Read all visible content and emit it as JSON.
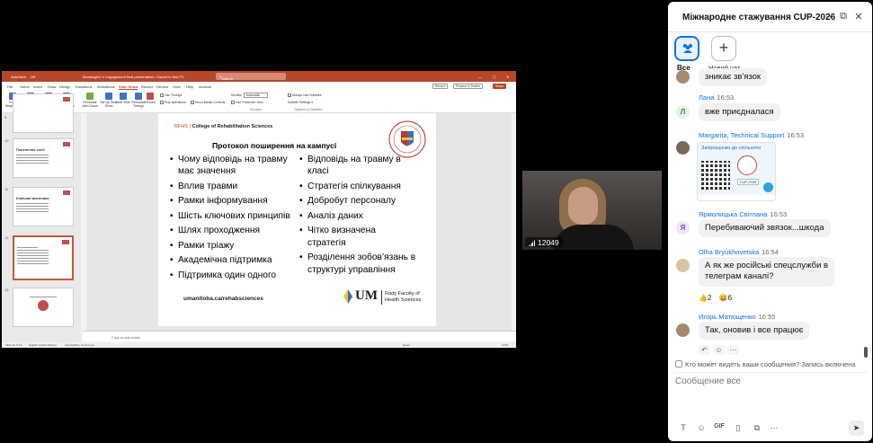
{
  "ppt": {
    "autosave": "AutoSave",
    "autosave_state": "Off",
    "doc_title": "Meaningful 'n' engagement final presentation • Saved to this PC",
    "search": "Search",
    "menu": [
      "File",
      "Home",
      "Insert",
      "Draw",
      "Design",
      "Transitions",
      "Animations",
      "Slide Show",
      "Record",
      "Review",
      "View",
      "Help",
      "Acrobat"
    ],
    "menu_active": "Slide Show",
    "record_btn": "Record",
    "present_btn": "Present in Teams",
    "share_btn": "Share",
    "ribbon": {
      "from_beginning": "From Beginning",
      "from_current": "From Current Slide",
      "present_teams": "Present in Teams",
      "custom_show": "Custom Slide Show",
      "rehearse_coach": "Rehearse with Coach",
      "setup_show": "Set Up Slide Show",
      "hide_slide": "Hide Slide",
      "rehearse_timings": "Rehearse Timings",
      "record": "Record",
      "use_timings": "Use Timings",
      "play_narrations": "Play Narrations",
      "show_media": "Show Media Controls",
      "monitor": "Monitor:",
      "monitor_value": "Automatic",
      "presenter_view": "Use Presenter View",
      "always_subtitles": "Always Use Subtitles",
      "subtitle_settings": "Subtitle Settings",
      "group_start": "Start Slide Show",
      "group_monitors": "Monitors",
      "group_captions": "Captions & Subtitles"
    },
    "thumbs": [
      {
        "num": "9",
        "title": ""
      },
      {
        "num": "10",
        "title": "Пояснення сесії"
      },
      {
        "num": "11",
        "title": "Ключові висновки"
      },
      {
        "num": "12",
        "title": ""
      },
      {
        "num": "13",
        "title": ""
      }
    ],
    "notes": "Click to add notes",
    "status": {
      "slide": "Slide 11 of 13",
      "lang": "English (United States)",
      "access": "Accessibility: Good to go",
      "notes": "Notes",
      "zoom": "113%"
    }
  },
  "slide": {
    "sub_label": "RFHS",
    "sub_college": "College of Rehabilitation Sciences",
    "title": "Протокол поширення на кампусі",
    "col1": [
      "Чому відповідь на травму має значення",
      "Вплив травми",
      "Рамки інформування",
      "Шість ключових принципів",
      "Шлях проходження",
      "Рамки тріажу",
      "Академічна підтримка",
      "Підтримка один одного"
    ],
    "col2": [
      "Відповідь на травму в класі",
      "Стратегія спілкування",
      "Добробут персоналу",
      "Аналіз даних",
      "Чітко визначена стратегія",
      "Розділення зобов’язань в структурі управління"
    ],
    "url": "umanitoba.ca/rehabsciences",
    "um": "UM",
    "faculty_line1": "Rady Faculty of",
    "faculty_line2": "Health Sciences"
  },
  "video": {
    "participant": "12049"
  },
  "chat": {
    "title": "Міжнародне стажування CUP-2026",
    "tab_all": "Все",
    "tab_new": "Новий чат",
    "messages": [
      {
        "text": "зникає зв'язок"
      },
      {
        "name": "Лана",
        "time": "16:53",
        "initial": "Л",
        "text": "вже приєдналася"
      },
      {
        "name": "Margarita, Technical Support",
        "time": "16:53",
        "image_caption": "Запрошуємо до спільноти",
        "image_btn": "CUP-2026"
      },
      {
        "name": "Ярмолицька Світлана",
        "time": "16:53",
        "initial": "Я",
        "text": "Перебиваючий звязок...шкода"
      },
      {
        "name": "Olha Bryukhovetska",
        "time": "16:54",
        "text1": "А як же російські спецслужби в",
        "text2": "телеграм каналі?",
        "react1": "2",
        "react2": "6"
      },
      {
        "name": "Игорь Матющенко",
        "time": "16:55",
        "text": "Так, оновив і все працює"
      }
    ],
    "notice": "Кто может видеть ваши сообщения? Запись включена",
    "placeholder": "Сообщение все",
    "toolbar_gif": "GIF"
  }
}
